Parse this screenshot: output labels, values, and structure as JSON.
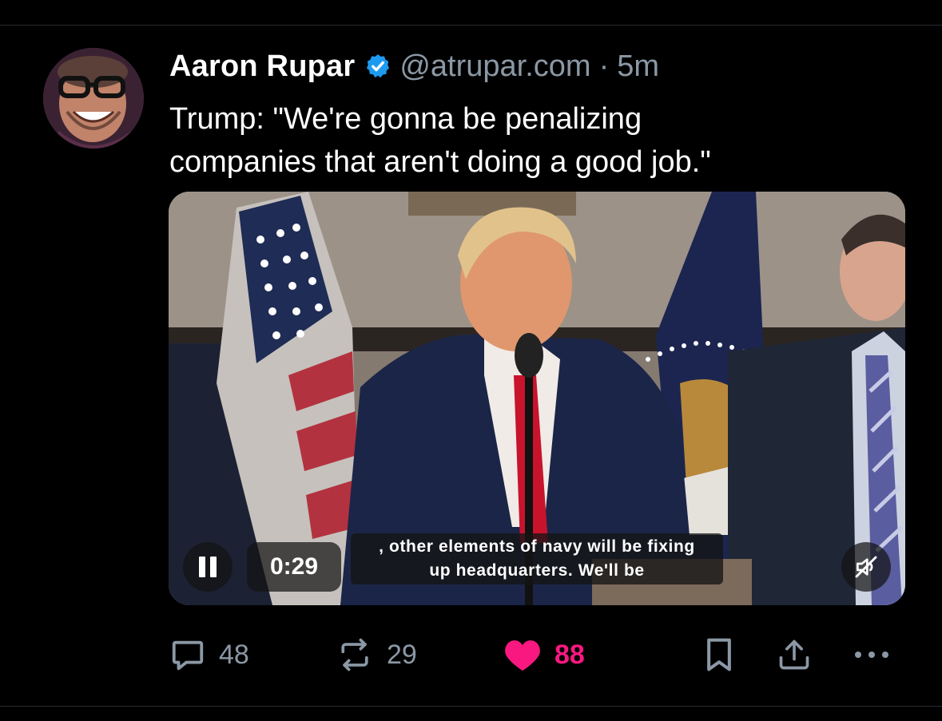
{
  "post": {
    "author_name": "Aaron Rupar",
    "handle": "@atrupar.com",
    "separator": "·",
    "time": "5m",
    "text": "Trump: \"We're gonna be penalizing\ncompanies that aren't doing a good job.\""
  },
  "video": {
    "timecode": "0:29",
    "caption_line1": ", other elements of navy will be fixing",
    "caption_line2": "up headquarters. We'll be",
    "muted": true,
    "playing": true
  },
  "actions": {
    "replies": "48",
    "reposts": "29",
    "likes": "88",
    "liked": true
  },
  "icons": {
    "verified": "verified-check-icon",
    "reply": "speech-bubble-icon",
    "repost": "repost-arrows-icon",
    "like": "heart-icon",
    "bookmark": "bookmark-icon",
    "share": "share-upload-icon",
    "more": "more-dots-icon",
    "pause": "pause-icon",
    "mute": "speaker-muted-icon"
  },
  "colors": {
    "background": "#000000",
    "text_primary": "#ffffff",
    "text_secondary": "#8b98a5",
    "verified_blue": "#1d9bf0",
    "like_pink": "#f91880",
    "divider": "#2a2d31"
  }
}
